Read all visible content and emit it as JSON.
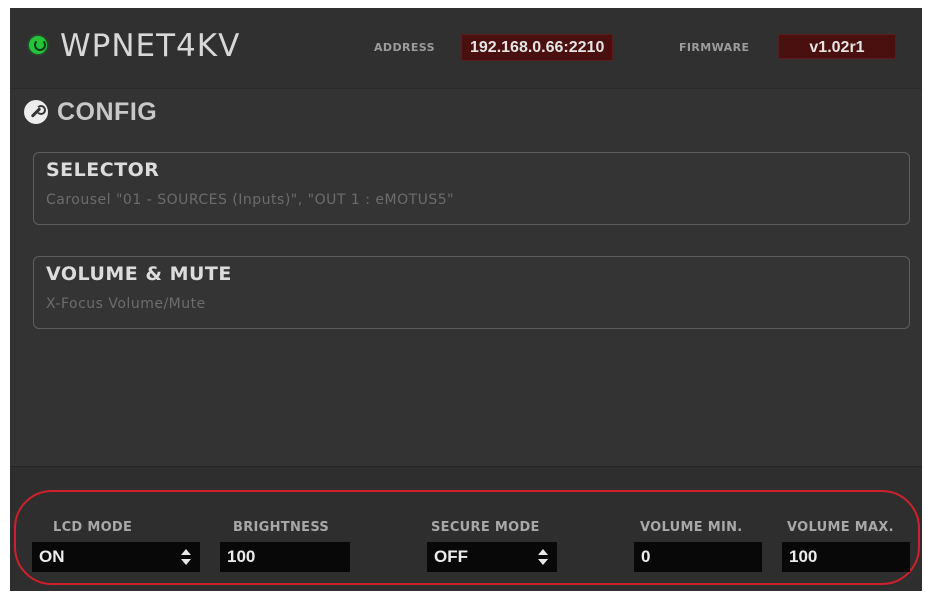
{
  "header": {
    "device_name": "WPNET4KV",
    "address_label": "ADDRESS",
    "address_value": "192.168.0.66:2210",
    "firmware_label": "FIRMWARE",
    "firmware_value": "v1.02r1",
    "power_icon": "power-icon",
    "power_color": "#25c43b"
  },
  "config": {
    "title": "CONFIG",
    "icon": "wrench-icon",
    "cards": [
      {
        "title": "SELECTOR",
        "subtitle": "Carousel \"01 - SOURCES (Inputs)\", \"OUT 1 : eMOTUS5\""
      },
      {
        "title": "VOLUME & MUTE",
        "subtitle": "X-Focus Volume/Mute"
      }
    ]
  },
  "footer": {
    "lcd_mode": {
      "label": "LCD MODE",
      "value": "ON"
    },
    "brightness": {
      "label": "BRIGHTNESS",
      "value": "100"
    },
    "secure_mode": {
      "label": "SECURE MODE",
      "value": "OFF"
    },
    "volume_min": {
      "label": "VOLUME MIN.",
      "value": "0"
    },
    "volume_max": {
      "label": "VOLUME MAX.",
      "value": "100"
    }
  },
  "colors": {
    "background": "#333333",
    "value_badge": "#4a1010",
    "highlight_outline": "#d0202a"
  }
}
